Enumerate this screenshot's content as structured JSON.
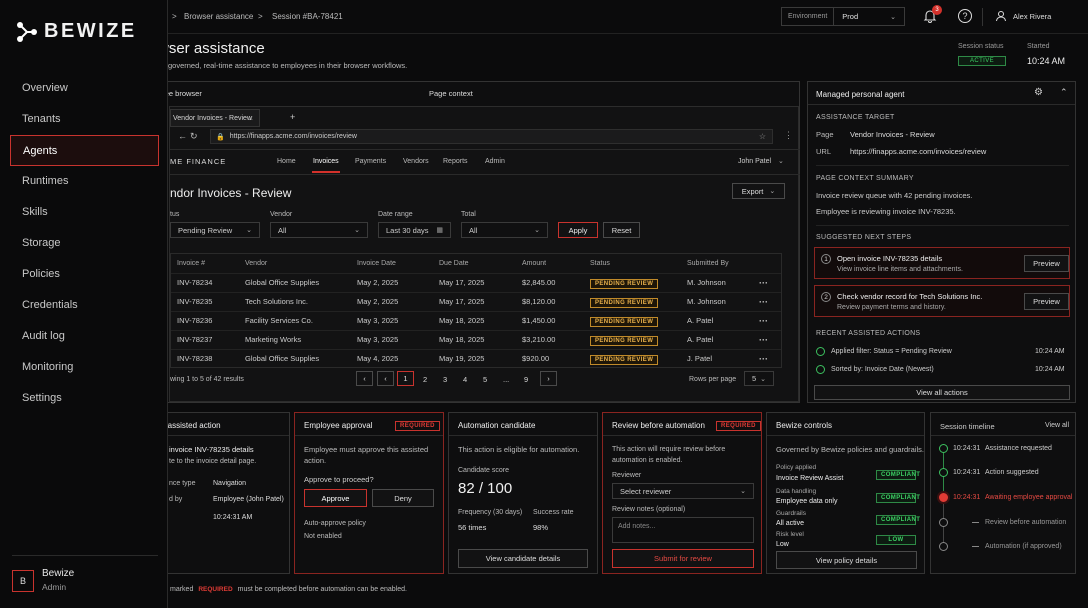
{
  "brand": {
    "name": "BEWIZE"
  },
  "nav": {
    "items": [
      "Overview",
      "Tenants",
      "Agents",
      "Runtimes",
      "Skills",
      "Storage",
      "Policies",
      "Credentials",
      "Audit log",
      "Monitoring",
      "Settings"
    ],
    "active": "Agents"
  },
  "user": {
    "initial": "B",
    "name": "Bewize",
    "role": "Admin"
  },
  "breadcrumb": {
    "section": "Browser assistance",
    "sep": ">",
    "session": "Session #BA-78421"
  },
  "topbar": {
    "env_label": "Environment",
    "env_value": "Prod",
    "notif_count": "3",
    "user_name": "Alex Rivera"
  },
  "page": {
    "title": "Browser assistance",
    "title_visible": "wser assistance",
    "subtitle_visible": "governed, real-time assistance to employees in their browser workflows.",
    "status_label": "Session status",
    "status_value": "ACTIVE",
    "started_label": "Started",
    "started_value": "10:24 AM"
  },
  "browser": {
    "panel_label": "yee browser",
    "context_label": "Page context",
    "tab": "Vendor Invoices - Review",
    "new_tab": "+",
    "url": "https://finapps.acme.com/invoices/review",
    "app_brand": "ME FINANCE",
    "app_nav": [
      "Home",
      "Invoices",
      "Payments",
      "Vendors",
      "Reports",
      "Admin"
    ],
    "app_nav_active": "Invoices",
    "app_user": "John Patel",
    "heading": "ndor Invoices - Review",
    "export": "Export",
    "filters": {
      "status_label": "tus",
      "status_value": "Pending Review",
      "vendor_label": "Vendor",
      "vendor_value": "All",
      "date_label": "Date range",
      "date_value": "Last 30 days",
      "total_label": "Total",
      "total_value": "All",
      "apply": "Apply",
      "reset": "Reset"
    },
    "columns": [
      "Invoice #",
      "Vendor",
      "Invoice Date",
      "Due Date",
      "Amount",
      "Status",
      "Submitted By"
    ],
    "rows": [
      [
        "INV-78234",
        "Global Office Supplies",
        "May 2, 2025",
        "May 17, 2025",
        "$2,845.00",
        "PENDING REVIEW",
        "M. Johnson"
      ],
      [
        "INV-78235",
        "Tech Solutions Inc.",
        "May 2, 2025",
        "May 17, 2025",
        "$8,120.00",
        "PENDING REVIEW",
        "M. Johnson"
      ],
      [
        "INV-78236",
        "Facility Services Co.",
        "May 3, 2025",
        "May 18, 2025",
        "$1,450.00",
        "PENDING REVIEW",
        "A. Patel"
      ],
      [
        "INV-78237",
        "Marketing Works",
        "May 3, 2025",
        "May 18, 2025",
        "$3,210.00",
        "PENDING REVIEW",
        "A. Patel"
      ],
      [
        "INV-78238",
        "Global Office Supplies",
        "May 4, 2025",
        "May 19, 2025",
        "$920.00",
        "PENDING REVIEW",
        "J. Patel"
      ]
    ],
    "showing": "wing 1 to 5 of 42 results",
    "pages": [
      "1",
      "2",
      "3",
      "4",
      "5",
      "...",
      "9"
    ],
    "rows_per_page_label": "Rows per page",
    "rows_per_page": "5"
  },
  "agent": {
    "title": "Managed personal agent",
    "target_label": "ASSISTANCE TARGET",
    "page_key": "Page",
    "page_val": "Vendor Invoices - Review",
    "url_key": "URL",
    "url_val": "https://finapps.acme.com/invoices/review",
    "summary_label": "PAGE CONTEXT SUMMARY",
    "summary_1": "Invoice review queue with 42 pending invoices.",
    "summary_2": "Employee is reviewing invoice INV-78235.",
    "steps_label": "SUGGESTED NEXT STEPS",
    "steps": [
      {
        "num": "1",
        "title": "Open invoice INV-78235 details",
        "desc": "View invoice line items and attachments.",
        "btn": "Preview"
      },
      {
        "num": "2",
        "title": "Check vendor record for Tech Solutions Inc.",
        "desc": "Review payment terms and history.",
        "btn": "Preview"
      }
    ],
    "recent_label": "RECENT ASSISTED ACTIONS",
    "recent": [
      {
        "text": "Applied filter: Status = Pending Review",
        "time": "10:24 AM"
      },
      {
        "text": "Sorted by: Invoice Date (Newest)",
        "time": "10:24 AM"
      }
    ],
    "view_all": "View all actions"
  },
  "cards": {
    "next": {
      "title": "e assisted action",
      "line1": "invoice INV-78235 details",
      "line2": "te to the invoice detail page.",
      "k1": "nce type",
      "v1": "Navigation",
      "k2": "d by",
      "v2": "Employee (John Patel)",
      "v3": "10:24:31 AM"
    },
    "approval": {
      "title": "Employee approval",
      "badge": "REQUIRED",
      "desc": "Employee must approve this assisted action.",
      "question": "Approve to proceed?",
      "approve": "Approve",
      "deny": "Deny",
      "auto_label": "Auto-approve policy",
      "auto_value": "Not enabled"
    },
    "automation": {
      "title": "Automation candidate",
      "desc": "This action is eligible for automation.",
      "score_label": "Candidate score",
      "score": "82 / 100",
      "freq_label": "Frequency (30 days)",
      "freq": "56 times",
      "rate_label": "Success rate",
      "rate": "98%",
      "btn": "View candidate details"
    },
    "review": {
      "title": "Review before automation",
      "badge": "REQUIRED",
      "desc": "This action will require review before automation is enabled.",
      "reviewer_label": "Reviewer",
      "reviewer_placeholder": "Select reviewer",
      "notes_label": "Review notes (optional)",
      "notes_placeholder": "Add notes...",
      "btn": "Submit for review"
    },
    "controls": {
      "title": "Bewize controls",
      "desc": "Governed by Bewize policies and guardrails.",
      "items": [
        {
          "k": "Policy applied",
          "v": "Invoice Review Assist",
          "badge": "COMPLIANT"
        },
        {
          "k": "Data handling",
          "v": "Employee data only",
          "badge": "COMPLIANT"
        },
        {
          "k": "Guardrails",
          "v": "All active",
          "badge": "COMPLIANT"
        },
        {
          "k": "Risk level",
          "v": "Low",
          "badge": "LOW"
        }
      ],
      "btn": "View policy details"
    },
    "timeline": {
      "title": "Session timeline",
      "view_all": "View all",
      "items": [
        {
          "time": "10:24:31",
          "text": "Assistance requested",
          "state": "done"
        },
        {
          "time": "10:24:31",
          "text": "Action suggested",
          "state": "done"
        },
        {
          "time": "10:24:31",
          "text": "Awaiting employee approval",
          "state": "current"
        },
        {
          "time": "",
          "text": "Review before automation",
          "state": "pending"
        },
        {
          "time": "",
          "text": "Automation (if approved)",
          "state": "pending"
        }
      ]
    }
  },
  "footer": {
    "pre": "marked",
    "badge": "REQUIRED",
    "post": "must be completed before automation can be enabled."
  }
}
